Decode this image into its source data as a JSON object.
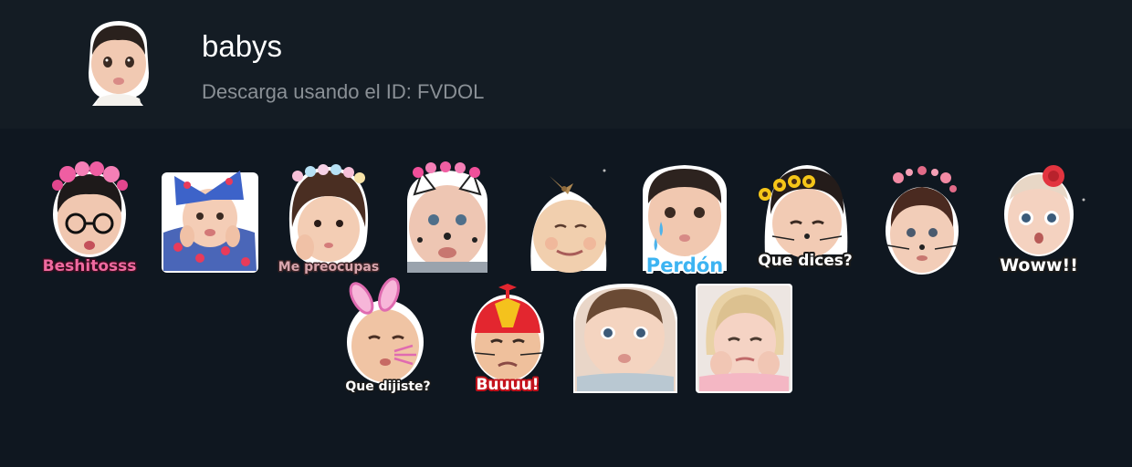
{
  "pack": {
    "title": "babys",
    "subtitle": "Descarga usando el ID: FVDOL",
    "icon": "baby-face-sticker-icon"
  },
  "stickers": [
    {
      "name": "sticker-beshitosss",
      "caption": "Beshitosss",
      "caption_color": "#f06aa0"
    },
    {
      "name": "sticker-flower-bow",
      "caption": ""
    },
    {
      "name": "sticker-me-preocupas",
      "caption": "Me preocupas",
      "caption_color": "#d9a6ae"
    },
    {
      "name": "sticker-cat-ears",
      "caption": ""
    },
    {
      "name": "sticker-top-knot",
      "caption": ""
    },
    {
      "name": "sticker-perdon",
      "caption": "Perdón",
      "caption_color": "#3db4f2"
    },
    {
      "name": "sticker-que-dices",
      "caption": "Que dices?",
      "caption_color": "#ffffff"
    },
    {
      "name": "sticker-hearts",
      "caption": ""
    },
    {
      "name": "sticker-woww",
      "caption": "Woww!!",
      "caption_color": "#ffffff"
    },
    {
      "name": "sticker-que-dijiste",
      "caption": "Que dijiste?",
      "caption_color": "#ffffff"
    },
    {
      "name": "sticker-buuuu",
      "caption": "Buuuu!",
      "caption_color": "#ffffff"
    },
    {
      "name": "sticker-chubby-baby",
      "caption": ""
    },
    {
      "name": "sticker-blonde-baby",
      "caption": ""
    }
  ]
}
